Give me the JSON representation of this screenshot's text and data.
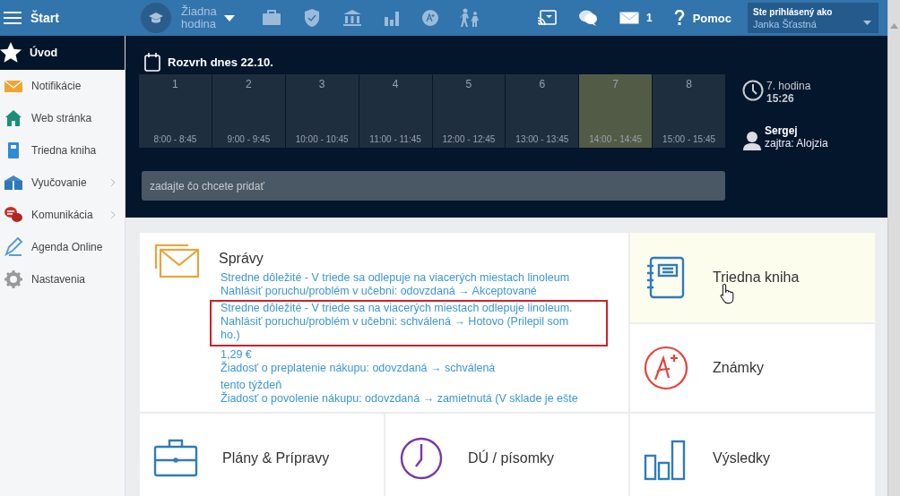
{
  "topbar": {
    "menu_label": "Štart",
    "lesson": "Žiadna hodina",
    "mail_count": "1",
    "help": "Pomoc",
    "user_caption": "Ste prihlásený ako",
    "user_name": "Janka Šťastná"
  },
  "sidebar": {
    "items": [
      {
        "label": "Úvod",
        "selected": true,
        "submenu": false
      },
      {
        "label": "Notifikácie",
        "selected": false,
        "submenu": false
      },
      {
        "label": "Web stránka",
        "selected": false,
        "submenu": false
      },
      {
        "label": "Triedna kniha",
        "selected": false,
        "submenu": false
      },
      {
        "label": "Vyučovanie",
        "selected": false,
        "submenu": true
      },
      {
        "label": "Komunikácia",
        "selected": false,
        "submenu": true
      },
      {
        "label": "Agenda Online",
        "selected": false,
        "submenu": false
      },
      {
        "label": "Nastavenia",
        "selected": false,
        "submenu": false
      }
    ]
  },
  "schedule": {
    "title": "Rozvrh dnes 22.10.",
    "periods": [
      {
        "number": "1",
        "time": "8:00 - 8:45",
        "current": false
      },
      {
        "number": "2",
        "time": "9:00 - 9:45",
        "current": false
      },
      {
        "number": "3",
        "time": "10:00 - 10:45",
        "current": false
      },
      {
        "number": "4",
        "time": "11:00 - 11:45",
        "current": false
      },
      {
        "number": "5",
        "time": "12:00 - 12:45",
        "current": false
      },
      {
        "number": "6",
        "time": "13:00 - 13:45",
        "current": false
      },
      {
        "number": "7",
        "time": "14:00 - 14:45",
        "current": true
      },
      {
        "number": "8",
        "time": "15:00 - 15:45",
        "current": false
      }
    ],
    "current_period": "7. hodina",
    "clock": "15:26",
    "duty_name": "Sergej",
    "duty_tomorrow": "zajtra: Alojzia",
    "add_field": {
      "placeholder": "zadajte čo chcete pridať"
    }
  },
  "messages_tile": {
    "title": "Správy",
    "groups": [
      {
        "highlighted": false,
        "lines": [
          "Stredne dôležité - V triede sa odlepuje na viacerých miestach linoleum",
          "Nahlásiť poruchu/problém v učebni: odovzdaná → Akceptované"
        ]
      },
      {
        "highlighted": true,
        "lines": [
          "Stredne dôležité - V triede sa na viacerých miestach odlepuje linoleum.",
          "Nahlásiť poruchu/problém v učebni: schválená → Hotovo (Prilepil som ho.)"
        ]
      },
      {
        "highlighted": false,
        "lines": [
          "1,29 €",
          "Žiadosť o preplatenie nákupu: odovzdaná → schválená"
        ]
      },
      {
        "highlighted": false,
        "lines": [
          "tento týždeň",
          "Žiadosť o povolenie nákupu: odovzdaná → zamietnutá (V sklade je ešte"
        ]
      }
    ]
  },
  "tiles": [
    {
      "label": "Triedna kniha",
      "hovered": true
    },
    {
      "label": "Známky",
      "hovered": false
    },
    {
      "label": "Plány & Prípravy",
      "hovered": false
    },
    {
      "label": "DÚ / písomky",
      "hovered": false
    },
    {
      "label": "Výsledky",
      "hovered": false
    }
  ]
}
